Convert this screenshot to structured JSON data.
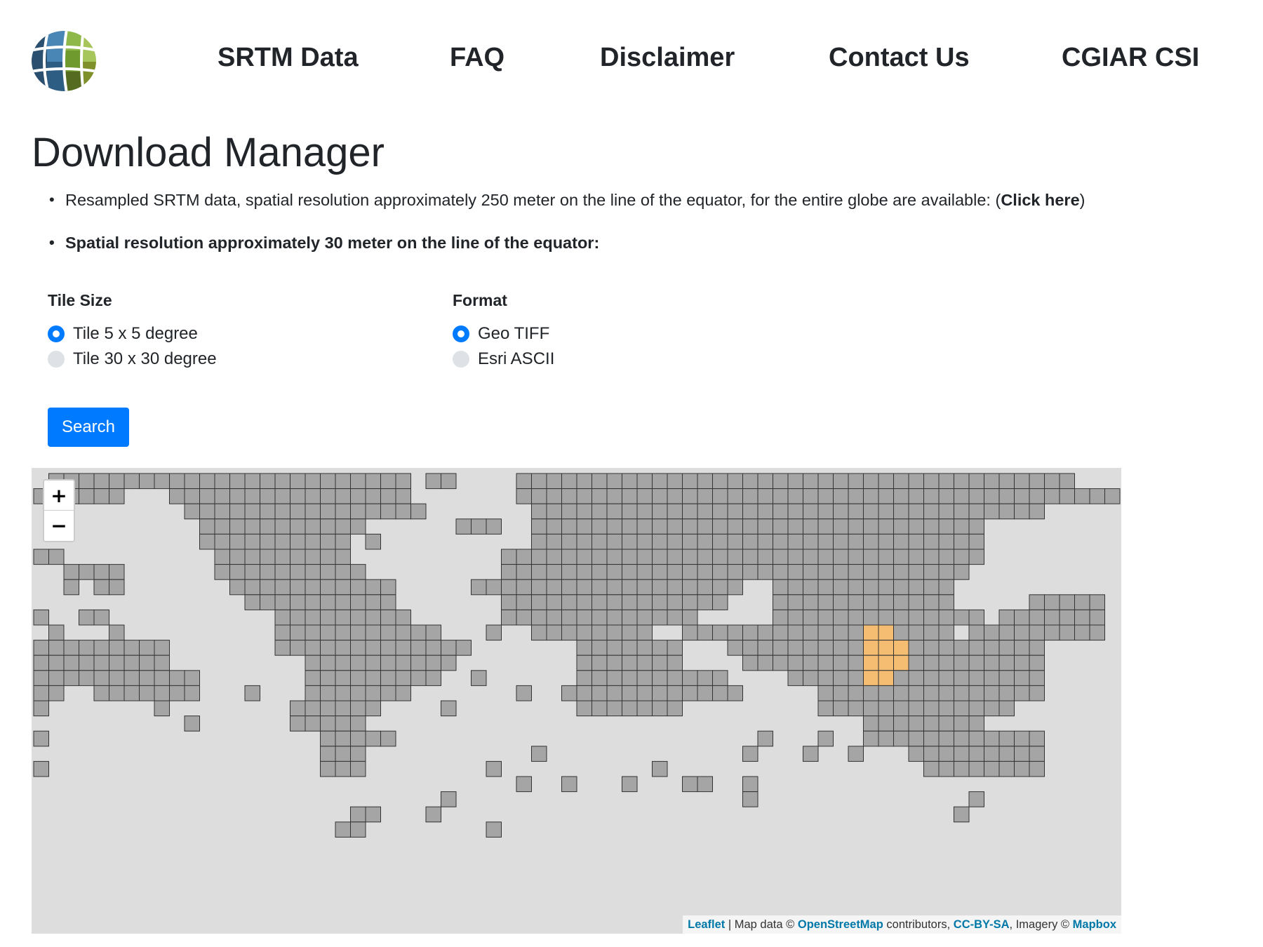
{
  "nav": {
    "logo_alt": "globe-logo",
    "links": [
      {
        "label": "SRTM Data"
      },
      {
        "label": "FAQ"
      },
      {
        "label": "Disclaimer"
      },
      {
        "label": "Contact Us"
      },
      {
        "label": "CGIAR CSI"
      }
    ]
  },
  "page": {
    "title": "Download Manager",
    "bullet1_text": "Resampled SRTM data, spatial resolution approximately 250 meter on the line of the equator, for the entire globe are available: (",
    "bullet1_link": "Click here",
    "bullet1_close": ")",
    "bullet2_text": "Spatial resolution approximately 30 meter on the line of the equator:"
  },
  "tile_size": {
    "label": "Tile Size",
    "options": [
      {
        "label": "Tile 5 x 5 degree",
        "checked": true
      },
      {
        "label": "Tile 30 x 30 degree",
        "checked": false
      }
    ]
  },
  "format": {
    "label": "Format",
    "options": [
      {
        "label": "Geo TIFF",
        "checked": true
      },
      {
        "label": "Esri ASCII",
        "checked": false
      }
    ]
  },
  "search_button": "Search",
  "map": {
    "zoom_in": "+",
    "zoom_out": "−",
    "attribution": {
      "leaflet": "Leaflet",
      "sep1": " | Map data © ",
      "osm": "OpenStreetMap",
      "sep2": " contributors, ",
      "license": "CC-BY-SA",
      "sep3": ", Imagery © ",
      "mapbox": "Mapbox"
    },
    "colors": {
      "background": "#dddddd",
      "tile": "#a5a5a5",
      "tile_border": "#333333",
      "selected_tile": "#f5bd72"
    },
    "selected_tiles": [
      {
        "row": 10,
        "col": 55
      },
      {
        "row": 10,
        "col": 56
      },
      {
        "row": 11,
        "col": 55
      },
      {
        "row": 11,
        "col": 56
      },
      {
        "row": 11,
        "col": 57
      },
      {
        "row": 12,
        "col": 55
      },
      {
        "row": 12,
        "col": 56
      },
      {
        "row": 12,
        "col": 57
      },
      {
        "row": 13,
        "col": 55
      },
      {
        "row": 13,
        "col": 56
      }
    ]
  }
}
